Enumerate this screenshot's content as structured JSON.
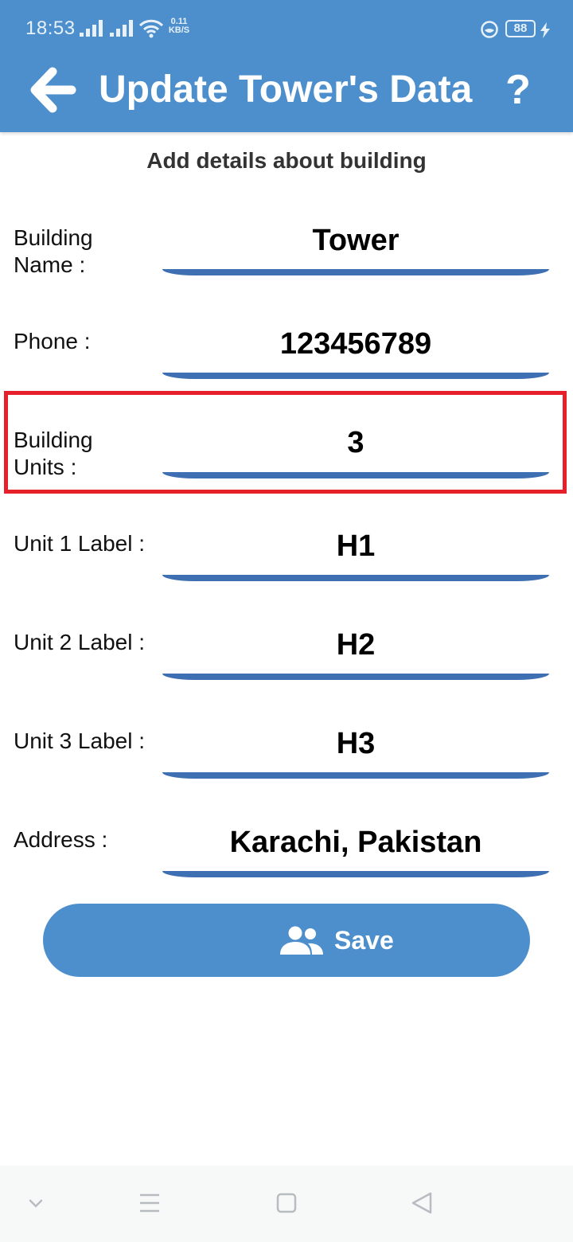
{
  "status_bar": {
    "time": "18:53",
    "net_speed_value": "0.11",
    "net_speed_unit": "KB/S",
    "battery": "88"
  },
  "header": {
    "title": "Update Tower's Data",
    "help_glyph": "?"
  },
  "form": {
    "subtitle": "Add details about building",
    "fields": [
      {
        "label_line1": "Building",
        "label_line2": "Name :",
        "value": "Tower"
      },
      {
        "label_line1": "Phone :",
        "label_line2": "",
        "value": "123456789"
      },
      {
        "label_line1": "Building",
        "label_line2": "Units :",
        "value": "3"
      },
      {
        "label_line1": "Unit 1 Label :",
        "label_line2": "",
        "value": "H1"
      },
      {
        "label_line1": "Unit 2 Label :",
        "label_line2": "",
        "value": "H2"
      },
      {
        "label_line1": "Unit 3 Label :",
        "label_line2": "",
        "value": "H3"
      },
      {
        "label_line1": "Address :",
        "label_line2": "",
        "value": "Karachi, Pakistan"
      }
    ]
  },
  "save_button": {
    "label": "Save",
    "icon": "group-icon"
  },
  "nav_bar": {
    "icons": [
      "chevron-down-icon",
      "menu-icon",
      "home-square-icon",
      "back-triangle-icon"
    ]
  },
  "colors": {
    "primary": "#4c8fcc",
    "underline": "#3f6fb3",
    "highlight": "#e5202a"
  }
}
